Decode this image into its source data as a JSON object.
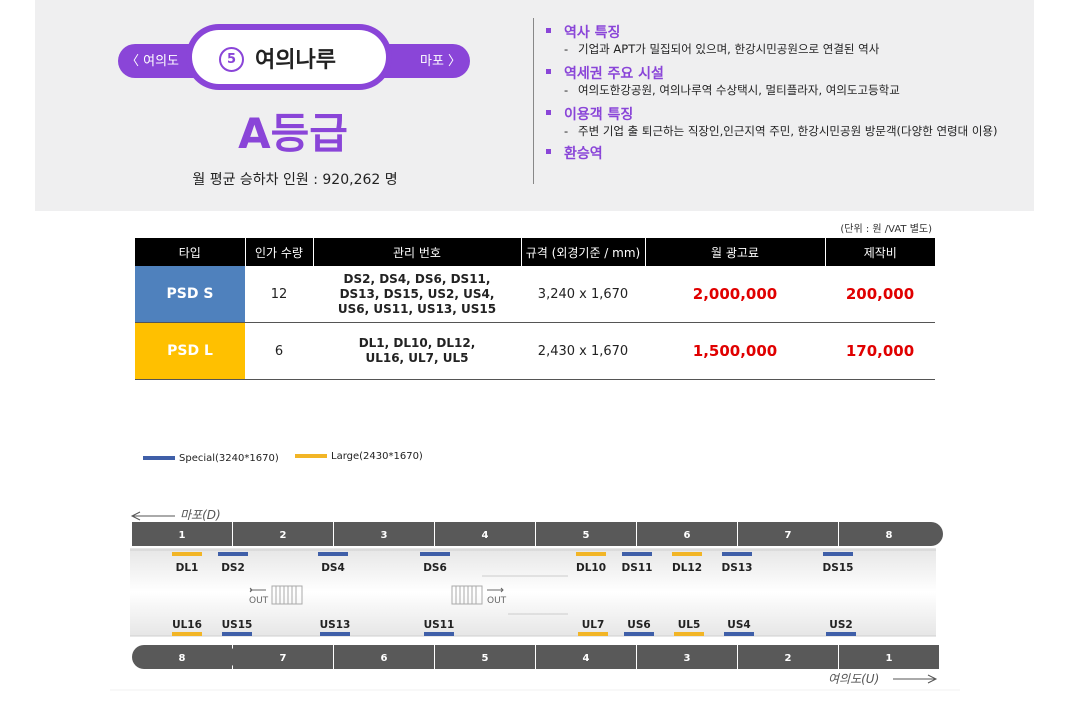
{
  "station": {
    "prev": "〈 여의도",
    "next": "마포 〉",
    "number": "5",
    "name": "여의나루",
    "grade": "A등급",
    "riders_label": "월 평균 승하차 인원 :",
    "riders_value": "920,262 명"
  },
  "sections": [
    {
      "title": "역사 특징",
      "desc": "기업과 APT가 밀집되어 있으며, 한강시민공원으로 연결된 역사"
    },
    {
      "title": "역세권 주요 시설",
      "desc": "여의도한강공원, 여의나루역 수상택시, 멀티플라자, 여의도고등학교"
    },
    {
      "title": "이용객 특징",
      "desc": "주변 기업 출 퇴근하는 직장인,인근지역 주민, 한강시민공원 방문객(다양한 연령대 이용)"
    },
    {
      "title": "환승역",
      "desc": ""
    }
  ],
  "unit_note": "(단위 : 원 /VAT 별도)",
  "table": {
    "headers": [
      "타입",
      "인가 수량",
      "관리 번호",
      "규격 (외경기준 / mm)",
      "월 광고료",
      "제작비"
    ],
    "rows": [
      {
        "type": "PSD S",
        "qty": "12",
        "ids": "DS2, DS4, DS6, DS11, DS13, DS15, US2, US4, US6, US11, US13, US15",
        "size": "3,240 x 1,670",
        "fee": "2,000,000",
        "cost": "200,000",
        "color": "#4f81bd"
      },
      {
        "type": "PSD L",
        "qty": "6",
        "ids": "DL1, DL10, DL12, UL16, UL7, UL5",
        "size": "2,430 x 1,670",
        "fee": "1,500,000",
        "cost": "170,000",
        "color": "#ffc000"
      }
    ]
  },
  "legend": [
    {
      "label": "Special(3240*1670)",
      "color": "#3f5fa8"
    },
    {
      "label": "Large(2430*1670)",
      "color": "#f2b526"
    }
  ],
  "diagram": {
    "top_direction": "마포(D)",
    "bottom_direction": "여의도(U)",
    "top_cars": [
      "1",
      "2",
      "3",
      "4",
      "5",
      "6",
      "7",
      "8"
    ],
    "bottom_cars": [
      "8",
      "7",
      "6",
      "5",
      "4",
      "3",
      "2",
      "1"
    ],
    "top_doors": [
      {
        "label": "DL1",
        "kind": "L"
      },
      {
        "label": "DS2",
        "kind": "S"
      },
      {
        "label": "DS4",
        "kind": "S"
      },
      {
        "label": "DS6",
        "kind": "S"
      },
      {
        "label": "DL10",
        "kind": "L"
      },
      {
        "label": "DS11",
        "kind": "S"
      },
      {
        "label": "DL12",
        "kind": "L"
      },
      {
        "label": "DS13",
        "kind": "S"
      },
      {
        "label": "DS15",
        "kind": "S"
      }
    ],
    "bottom_doors": [
      {
        "label": "UL16",
        "kind": "L"
      },
      {
        "label": "US15",
        "kind": "S"
      },
      {
        "label": "US13",
        "kind": "S"
      },
      {
        "label": "US11",
        "kind": "S"
      },
      {
        "label": "UL7",
        "kind": "L"
      },
      {
        "label": "US6",
        "kind": "S"
      },
      {
        "label": "UL5",
        "kind": "L"
      },
      {
        "label": "US4",
        "kind": "S"
      },
      {
        "label": "US2",
        "kind": "S"
      }
    ],
    "exits": [
      "OUT",
      "OUT"
    ]
  }
}
